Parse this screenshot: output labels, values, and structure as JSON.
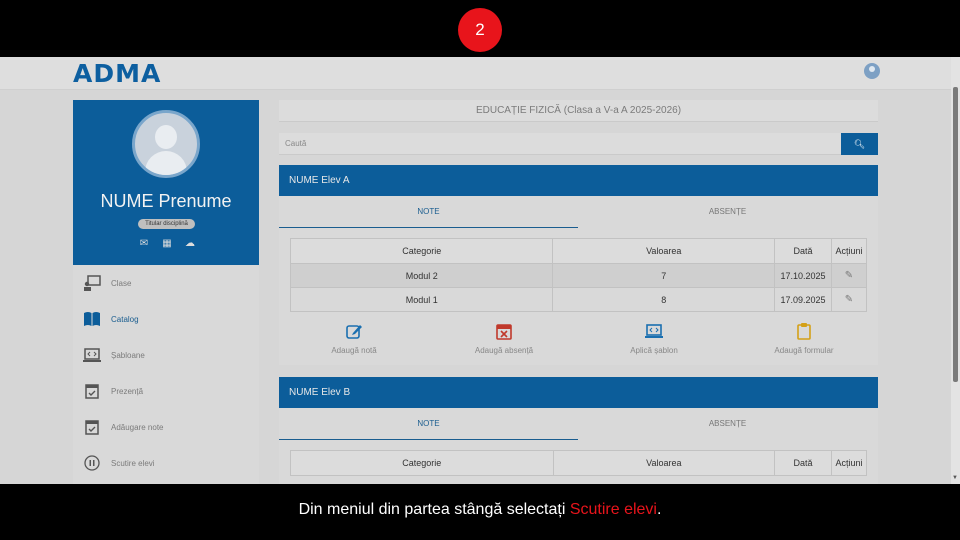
{
  "step": "2",
  "app": {
    "logo": "ADMA"
  },
  "profile": {
    "name": "NUME Prenume",
    "role": "Titular disciplină",
    "icons": [
      "envelope-icon",
      "calendar-icon",
      "cloud-upload-icon"
    ]
  },
  "menu": [
    {
      "label": "Clase",
      "icon": "classroom-icon"
    },
    {
      "label": "Catalog",
      "icon": "book-icon"
    },
    {
      "label": "Șabloane",
      "icon": "template-icon"
    },
    {
      "label": "Prezență",
      "icon": "calendar-check-icon"
    },
    {
      "label": "Adăugare note",
      "icon": "calendar-check-icon"
    },
    {
      "label": "Scutire elevi",
      "icon": "pause-circle-icon"
    }
  ],
  "subject": "EDUCAȚIE FIZICĂ (Clasa a V-a A 2025-2026)",
  "search": {
    "placeholder": "Caută"
  },
  "students": [
    {
      "name": "NUME Elev A",
      "tabs": [
        "NOTE",
        "ABSENȚE"
      ],
      "columns": [
        "Categorie",
        "Valoarea",
        "Dată",
        "Acțiuni"
      ],
      "rows": [
        {
          "category": "Modul 2",
          "value": "7",
          "date": "17.10.2025"
        },
        {
          "category": "Modul 1",
          "value": "8",
          "date": "17.09.2025"
        }
      ],
      "actions": [
        "Adaugă notă",
        "Adaugă absență",
        "Aplică șablon",
        "Adaugă formular"
      ]
    },
    {
      "name": "NUME Elev B",
      "tabs": [
        "NOTE",
        "ABSENȚE"
      ],
      "columns": [
        "Categorie",
        "Valoarea",
        "Dată",
        "Acțiuni"
      ]
    }
  ],
  "colors": {
    "primary": "#0c5d9a",
    "highlight": "#e8141b"
  },
  "caption": {
    "before": "Din meniul din partea stângă selectați ",
    "highlight": "Scutire elevi",
    "after": "."
  }
}
